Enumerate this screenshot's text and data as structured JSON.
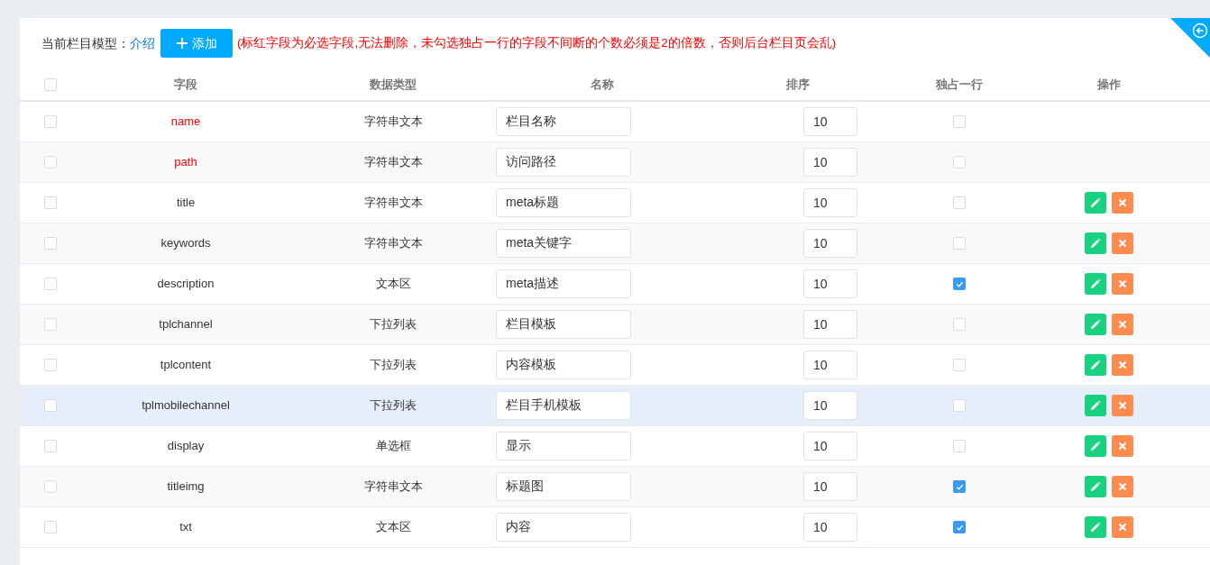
{
  "toolbar": {
    "label": "当前栏目模型：",
    "link": "介绍",
    "add_button": "添加",
    "notice": "(标红字段为必选字段,无法删除，未勾选独占一行的字段不间断的个数必须是2的倍数，否则后台栏目页会乱)"
  },
  "table": {
    "columns": [
      "字段",
      "数据类型",
      "名称",
      "排序",
      "独占一行",
      "操作"
    ],
    "select_all": false,
    "rows": [
      {
        "field": "name",
        "type": "字符串文本",
        "label": "栏目名称",
        "order": "10",
        "single_line": false,
        "required": true,
        "checked": false,
        "hovered": false
      },
      {
        "field": "path",
        "type": "字符串文本",
        "label": "访问路径",
        "order": "10",
        "single_line": false,
        "required": true,
        "checked": false,
        "hovered": false
      },
      {
        "field": "title",
        "type": "字符串文本",
        "label": "meta标题",
        "order": "10",
        "single_line": false,
        "required": false,
        "checked": false,
        "hovered": false
      },
      {
        "field": "keywords",
        "type": "字符串文本",
        "label": "meta关键字",
        "order": "10",
        "single_line": false,
        "required": false,
        "checked": false,
        "hovered": false
      },
      {
        "field": "description",
        "type": "文本区",
        "label": "meta描述",
        "order": "10",
        "single_line": true,
        "required": false,
        "checked": false,
        "hovered": false
      },
      {
        "field": "tplchannel",
        "type": "下拉列表",
        "label": "栏目模板",
        "order": "10",
        "single_line": false,
        "required": false,
        "checked": false,
        "hovered": false
      },
      {
        "field": "tplcontent",
        "type": "下拉列表",
        "label": "内容模板",
        "order": "10",
        "single_line": false,
        "required": false,
        "checked": false,
        "hovered": false
      },
      {
        "field": "tplmobilechannel",
        "type": "下拉列表",
        "label": "栏目手机模板",
        "order": "10",
        "single_line": false,
        "required": false,
        "checked": false,
        "hovered": true
      },
      {
        "field": "display",
        "type": "单选框",
        "label": "显示",
        "order": "10",
        "single_line": false,
        "required": false,
        "checked": false,
        "hovered": false
      },
      {
        "field": "titleimg",
        "type": "字符串文本",
        "label": "标题图",
        "order": "10",
        "single_line": true,
        "required": false,
        "checked": false,
        "hovered": false
      },
      {
        "field": "txt",
        "type": "文本区",
        "label": "内容",
        "order": "10",
        "single_line": true,
        "required": false,
        "checked": false,
        "hovered": false
      }
    ]
  }
}
